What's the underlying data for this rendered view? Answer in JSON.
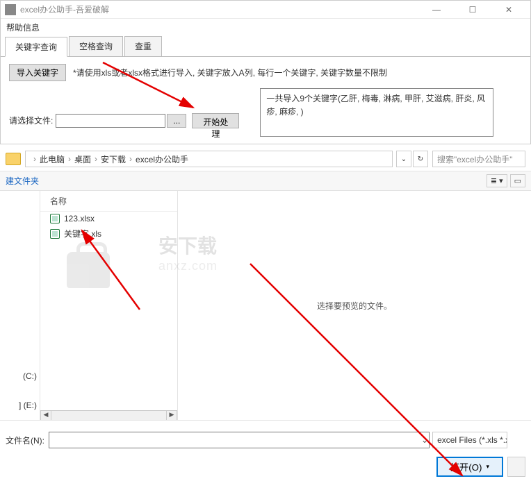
{
  "window": {
    "title": "excel办公助手-吾爱破解",
    "menu": {
      "help": "帮助信息"
    }
  },
  "tabs": {
    "t1": "关键字查询",
    "t2": "空格查询",
    "t3": "查重"
  },
  "panel": {
    "import_btn": "导入关键字",
    "hint": "*请使用xls或者xlsx格式进行导入, 关键字放入A列, 每行一个关键字, 关键字数量不限制",
    "choose_label": "请选择文件:",
    "browse_btn": "...",
    "start_btn": "开始处理",
    "status": "一共导入9个关键字(乙肝, 梅毒, 淋病, 甲肝, 艾滋病, 肝炎, 风疹, 麻疹,  )"
  },
  "dialog": {
    "breadcrumb": {
      "p1": "此电脑",
      "p2": "桌面",
      "p3": "安下载",
      "p4": "excel办公助手"
    },
    "search_placeholder": "搜索\"excel办公助手\"",
    "new_folder": "建文件夹",
    "col_name": "名称",
    "files": {
      "f1": "123.xlsx",
      "f2": "关键字.xls"
    },
    "preview_msg": "选择要预览的文件。",
    "drives": {
      "c": "(C:)",
      "e": "] (E:)"
    },
    "filename_label": "文件名(N):",
    "filter": "excel Files (*.xls *.xlsx)",
    "open_btn": "打开(O)"
  },
  "watermark": {
    "cn": "安下载",
    "en": "anxz.com"
  }
}
